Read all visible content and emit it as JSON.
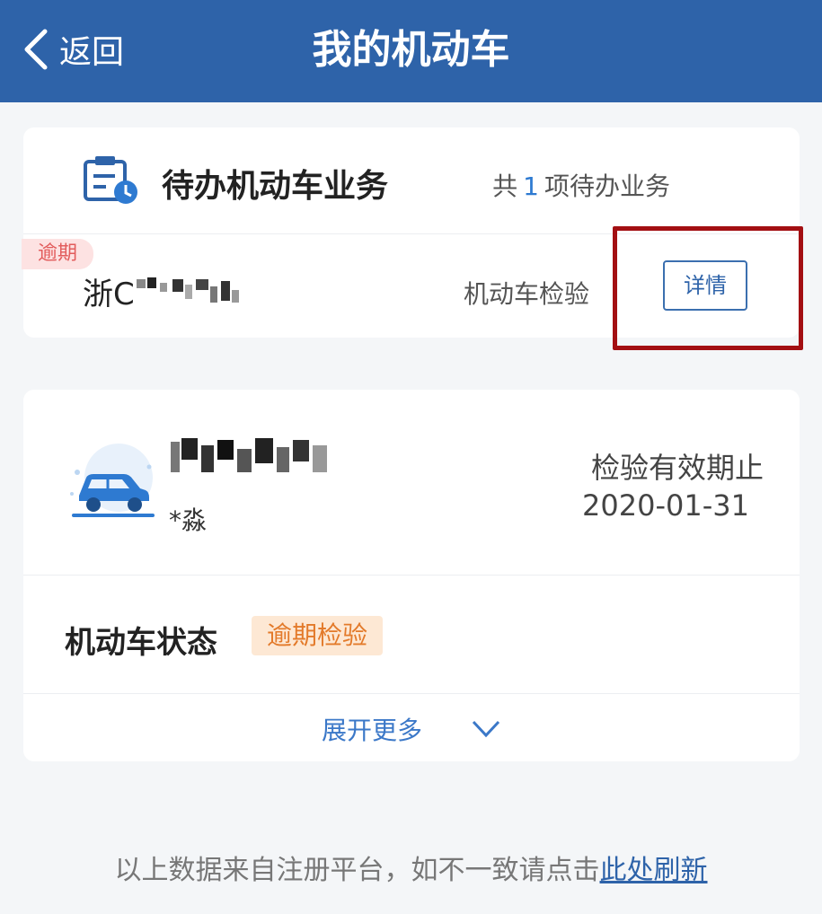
{
  "header": {
    "back_label": "返回",
    "title": "我的机动车"
  },
  "todo": {
    "title": "待办机动车业务",
    "count_prefix": "共",
    "count": "1",
    "count_suffix": "项待办业务",
    "item": {
      "tag": "逾期",
      "plate_prefix": "浙C",
      "service": "机动车检验",
      "detail_button": "详情"
    }
  },
  "vehicle": {
    "owner": "*淼",
    "valid_label": "检验有效期止",
    "valid_date": "2020-01-31",
    "status_label": "机动车状态",
    "status_badge": "逾期检验",
    "expand_label": "展开更多"
  },
  "footer": {
    "note": "以上数据来自注册平台，如不一致请点击",
    "link": "此处刷新"
  },
  "colors": {
    "header_bg": "#2e63a9",
    "accent": "#3b78c8",
    "overdue_red": "#e25c5c",
    "status_orange": "#e37a2a",
    "highlight_box": "#a30f12"
  },
  "icons": [
    "back-chevron-icon",
    "todo-clipboard-clock-icon",
    "car-icon",
    "chevron-down-icon"
  ]
}
